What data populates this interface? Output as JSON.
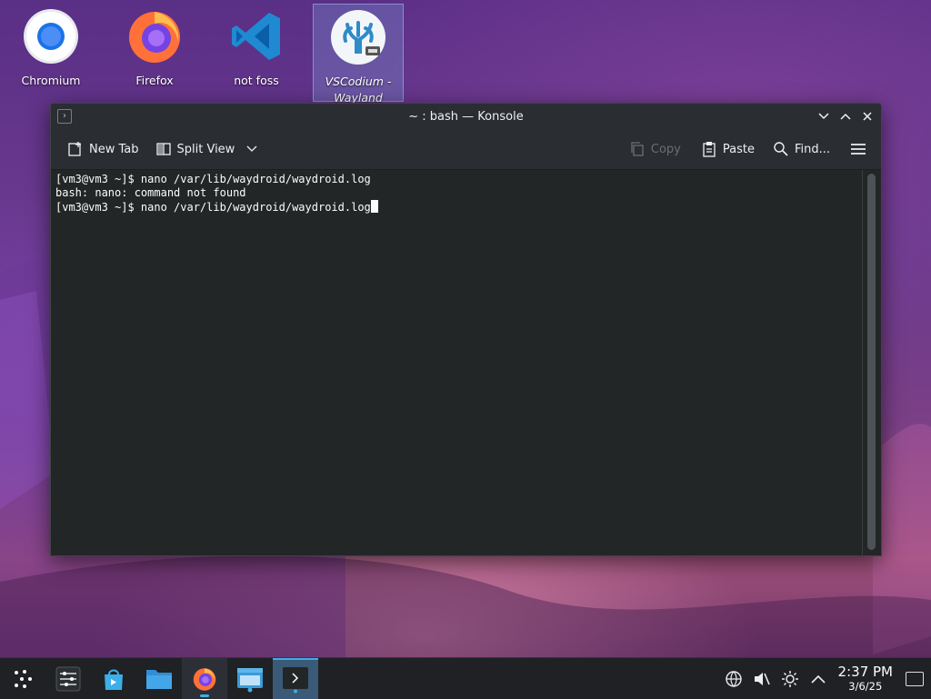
{
  "desktop": {
    "icons": [
      {
        "label": "Chromium",
        "icon": "chromium-icon"
      },
      {
        "label": "Firefox",
        "icon": "firefox-icon"
      },
      {
        "label": "not foss",
        "icon": "vscode-icon"
      },
      {
        "label": "VSCodium - Wayland",
        "icon": "vscodium-icon"
      }
    ]
  },
  "window": {
    "title": "~ : bash — Konsole",
    "toolbar": {
      "new_tab": "New Tab",
      "split_view": "Split View",
      "copy": "Copy",
      "paste": "Paste",
      "find": "Find..."
    },
    "terminal_lines": [
      "[vm3@vm3 ~]$ nano /var/lib/waydroid/waydroid.log",
      "bash: nano: command not found",
      "[vm3@vm3 ~]$ nano /var/lib/waydroid/waydroid.log"
    ]
  },
  "taskbar": {
    "apps": [
      "app-launcher",
      "system-settings",
      "discover",
      "dolphin",
      "firefox",
      "files",
      "konsole"
    ],
    "clock_time": "2:37 PM",
    "clock_date": "3/6/25"
  },
  "colors": {
    "terminal_bg": "#232627",
    "accent": "#3daee9"
  }
}
